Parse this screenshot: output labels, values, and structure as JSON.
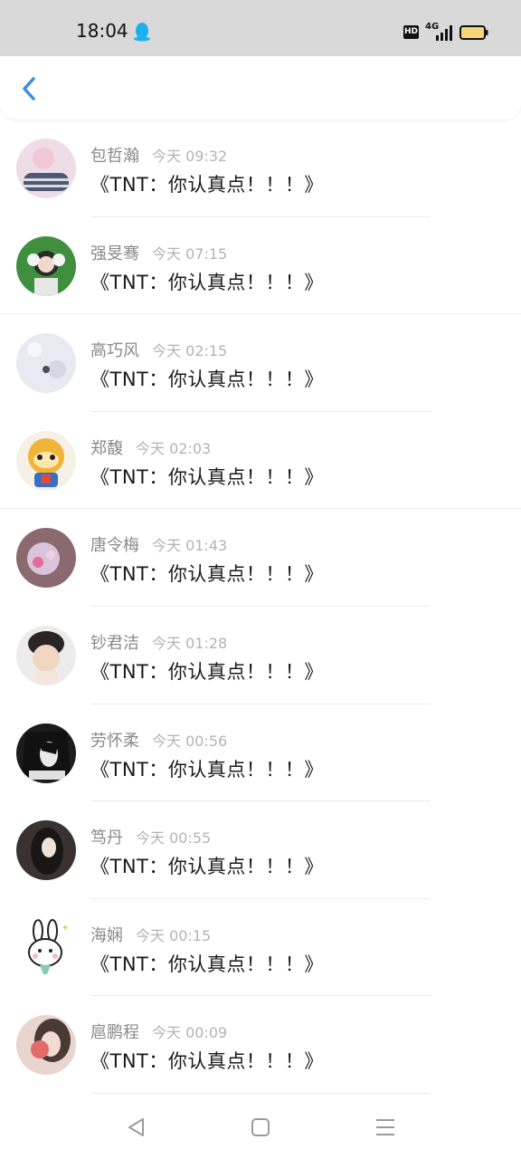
{
  "status": {
    "time": "18:04",
    "hd": "HD",
    "network": "4G",
    "battery_color": "#f5d67a"
  },
  "header": {
    "back_icon": "chevron-left-icon",
    "accent": "#3a8fd8"
  },
  "messages": [
    {
      "name": "包哲瀚",
      "time": "今天 09:32",
      "text": "《TNT：你认真点！！！》"
    },
    {
      "name": "强旻骞",
      "time": "今天 07:15",
      "text": "《TNT：你认真点！！！》"
    },
    {
      "name": "高巧风",
      "time": "今天 02:15",
      "text": "《TNT：你认真点！！！》"
    },
    {
      "name": "郑馥",
      "time": "今天 02:03",
      "text": "《TNT：你认真点！！！》"
    },
    {
      "name": "唐令梅",
      "time": "今天 01:43",
      "text": "《TNT：你认真点！！！》"
    },
    {
      "name": "钞君洁",
      "time": "今天 01:28",
      "text": "《TNT：你认真点！！！》"
    },
    {
      "name": "劳怀柔",
      "time": "今天 00:56",
      "text": "《TNT：你认真点！！！》"
    },
    {
      "name": "笃丹",
      "time": "今天 00:55",
      "text": "《TNT：你认真点！！！》"
    },
    {
      "name": "海娴",
      "time": "今天 00:15",
      "text": "《TNT：你认真点！！！》"
    },
    {
      "name": "扈鹏程",
      "time": "今天 00:09",
      "text": "《TNT：你认真点！！！》"
    }
  ],
  "nav": {
    "back": "triangle-back-icon",
    "home": "square-home-icon",
    "menu": "menu-lines-icon"
  }
}
